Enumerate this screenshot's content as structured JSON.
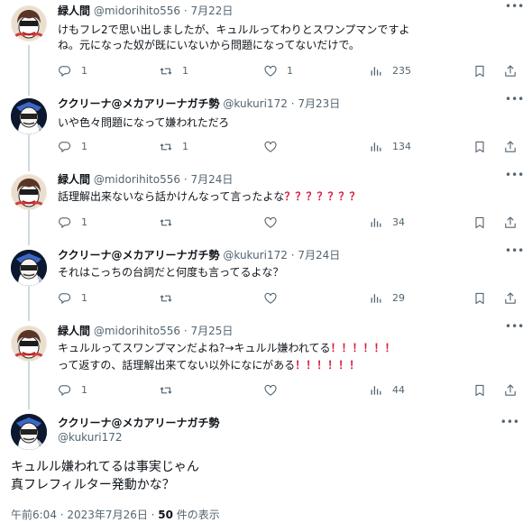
{
  "tweets": [
    {
      "name": "緑人間",
      "handle": "@midorihito556",
      "sep": "·",
      "date": "7月22日",
      "lines": [
        "けもフレ2で思い出しましたが、キュルルってわりとスワンプマンですよ",
        "ね。元になった奴が既にいないから問題になってないだけで。"
      ],
      "replies": "1",
      "retweets": "1",
      "likes": "1",
      "views": "235"
    },
    {
      "name": "ククリーナ@メカアリーナガチ勢",
      "handle": "@kukuri172",
      "sep": "·",
      "date": "7月23日",
      "lines": [
        "いや色々問題になって嫌われただろ"
      ],
      "replies": "1",
      "retweets": "1",
      "likes": "",
      "views": "134"
    },
    {
      "name": "緑人間",
      "handle": "@midorihito556",
      "sep": "·",
      "date": "7月24日",
      "line1": "話理解出来ないなら話かけんなって言ったよな",
      "line1_emph": "？？？？？？？",
      "replies": "1",
      "retweets": "",
      "likes": "",
      "views": "34"
    },
    {
      "name": "ククリーナ@メカアリーナガチ勢",
      "handle": "@kukuri172",
      "sep": "·",
      "date": "7月24日",
      "lines": [
        "それはこっちの台詞だと何度も言ってるよな？"
      ],
      "replies": "1",
      "retweets": "",
      "likes": "",
      "views": "29"
    },
    {
      "name": "緑人間",
      "handle": "@midorihito556",
      "sep": "·",
      "date": "7月25日",
      "line1": "キュルルってスワンプマンだよね?→キュルル嫌われてる",
      "line1_emph": "！！！！！！",
      "line2": "って返すの、話理解出来てない以外になにがある",
      "line2_emph": "！！！！！！",
      "replies": "1",
      "retweets": "",
      "likes": "",
      "views": "44"
    }
  ],
  "main": {
    "name": "ククリーナ@メカアリーナガチ勢",
    "handle": "@kukuri172",
    "text_line1": "キュルル嫌われてるは事実じゃん",
    "text_line2": "真フレフィルター発動かな？",
    "time": "午前6:04 · 2023年7月26日 · ",
    "views_count": "50",
    "views_suffix": " 件の表示"
  },
  "icons": {
    "reply": "reply-icon",
    "retweet": "retweet-icon",
    "like": "heart-icon",
    "views": "analytics-icon",
    "bookmark": "bookmark-icon",
    "share": "share-icon",
    "more": "more-icon"
  },
  "colors": {
    "text": "#0f1419",
    "secondary": "#536471",
    "emphasis": "#d61f3d",
    "thread_line": "#cfd9de"
  }
}
